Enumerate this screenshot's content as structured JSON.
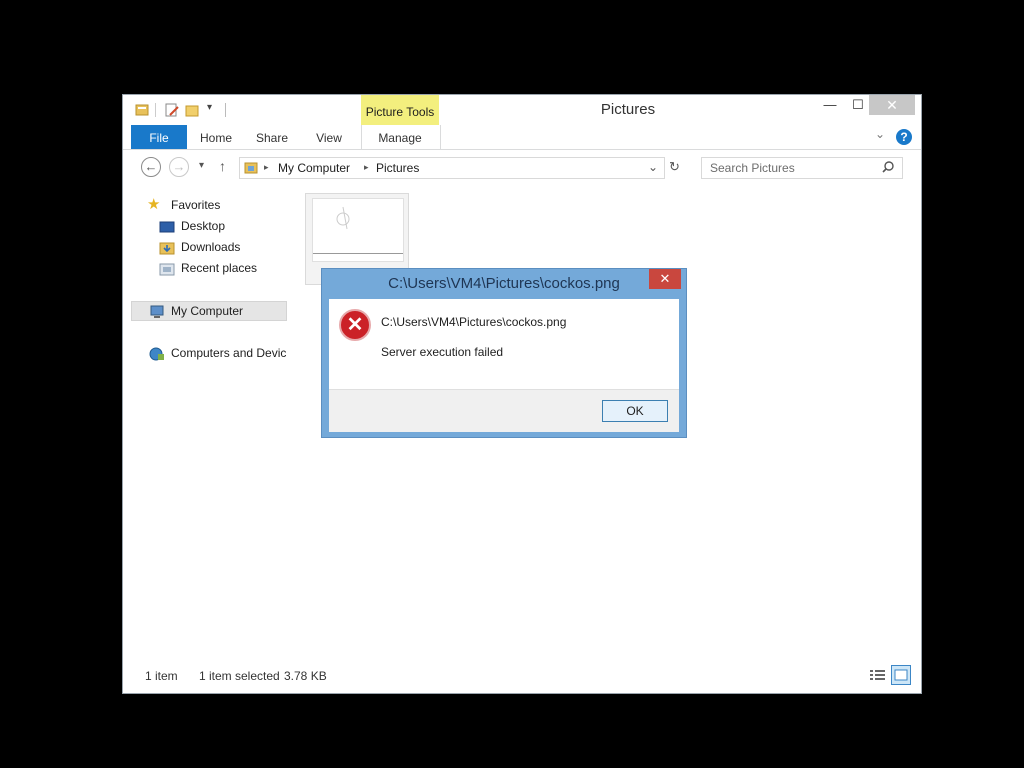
{
  "window": {
    "title": "Pictures",
    "contextual_tab_group": "Picture Tools",
    "minimize_glyph": "—",
    "maximize_glyph": "☐",
    "close_glyph": "✕"
  },
  "ribbon": {
    "tabs": [
      "File",
      "Home",
      "Share",
      "View",
      "Manage"
    ],
    "help_glyph": "?"
  },
  "address_bar": {
    "breadcrumb": [
      "My Computer",
      "Pictures"
    ],
    "search_placeholder": "Search Pictures"
  },
  "nav_pane": {
    "favorites_label": "Favorites",
    "favorites": [
      "Desktop",
      "Downloads",
      "Recent places"
    ],
    "my_computer": "My Computer",
    "network": "Computers and Devic"
  },
  "status_bar": {
    "item_count": "1 item",
    "selection": "1 item selected",
    "size": "3.78 KB"
  },
  "dialog": {
    "title": "C:\\Users\\VM4\\Pictures\\cockos.png",
    "message_path": "C:\\Users\\VM4\\Pictures\\cockos.png",
    "message": "Server execution failed",
    "ok_label": "OK",
    "close_glyph": "✕",
    "error_glyph": "✕"
  },
  "colors": {
    "accent": "#1979ca",
    "contextual_tab": "#f3ef7e",
    "dialog_frame": "#74a9d9",
    "error": "#cb2127"
  }
}
